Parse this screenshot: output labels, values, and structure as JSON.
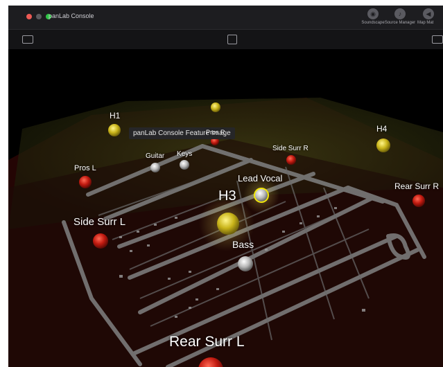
{
  "window": {
    "title": "panLab Console",
    "traffic_lights": [
      "#ed5a54",
      "#5a5a5e",
      "#2ec444"
    ]
  },
  "toolbar": {
    "soundscape_label": "Soundscape",
    "source_manager_label": "Source Manager",
    "map_label": "Map Mat"
  },
  "tooltip": {
    "text": "panLab Console Feature Image"
  },
  "sources": {
    "h1": "H1",
    "pros_r": "Pros R",
    "h4": "H4",
    "guitar": "Guitar",
    "keys": "Keys",
    "side_surr_r": "Side Surr R",
    "pros_l": "Pros L",
    "lead_vocal": "Lead Vocal",
    "rear_surr_r": "Rear Surr R",
    "h3": "H3",
    "side_surr_l": "Side Surr L",
    "bass": "Bass",
    "rear_surr_l": "Rear Surr L"
  },
  "colors": {
    "yellow_source": "#c9b41a",
    "red_source": "#c11a10",
    "gray_source": "#b8b8b8",
    "selected_ring": "#f2e80a"
  }
}
